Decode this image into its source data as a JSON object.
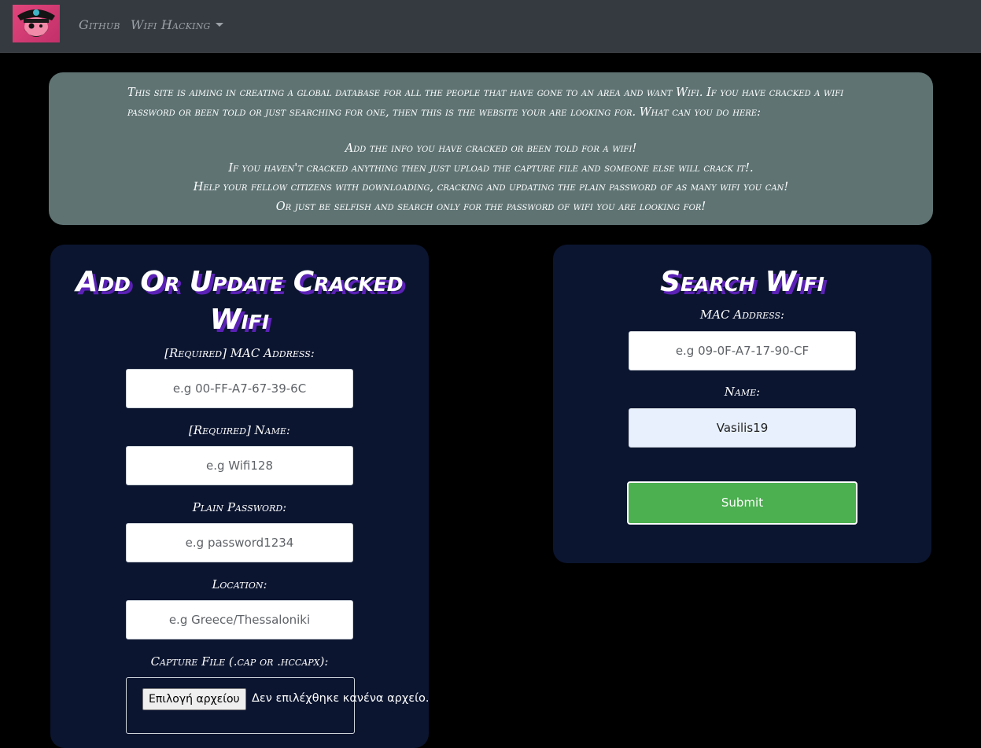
{
  "nav": {
    "links": [
      "Github",
      "Wifi Hacking"
    ]
  },
  "intro": {
    "paragraph": "This site is aiming in creating a global database for all the people that have gone to an area and want Wifi. If you have cracked a wifi password or been told or just searching for one, then this is the website your are looking for. What can you do here:",
    "items": [
      "Add the info you have cracked or been told for a wifi!",
      "If you haven't cracked anything then just upload the capture file and someone else will crack it!.",
      "Help your fellow citizens with downloading, cracking and updating the plain password of as many wifi you can!",
      "Or just be selfish and search only for the password of wifi you are looking for!"
    ]
  },
  "add_form": {
    "title_line1": "Add Or Update Cracked",
    "title_line2": "Wifi",
    "mac_label": "[Required] MAC Address:",
    "mac_placeholder": "e.g 00-FF-A7-67-39-6C",
    "name_label": "[Required] Name:",
    "name_placeholder": "e.g Wifi128",
    "password_label": "Plain Password:",
    "password_placeholder": "e.g password1234",
    "location_label": "Location:",
    "location_placeholder": "e.g Greece/Thessaloniki",
    "capture_label": "Capture File (.cap or .hccapx):",
    "file_button": "Επιλογή αρχείου",
    "file_status": "Δεν επιλέχθηκε κανένα αρχείο."
  },
  "search_form": {
    "title": "Search Wifi",
    "mac_label": "MAC Address:",
    "mac_placeholder": "e.g 09-0F-A7-17-90-CF",
    "name_label": "Name:",
    "name_value": "Vasilis19",
    "submit_label": "Submit"
  },
  "colors": {
    "navbar": "#343a40",
    "intro_bg": "#5f7373",
    "card_bg": "#0b1530",
    "submit_bg": "#4caf50",
    "title_shadow": "#5b21b6",
    "logo_bg": "#e0457b"
  }
}
